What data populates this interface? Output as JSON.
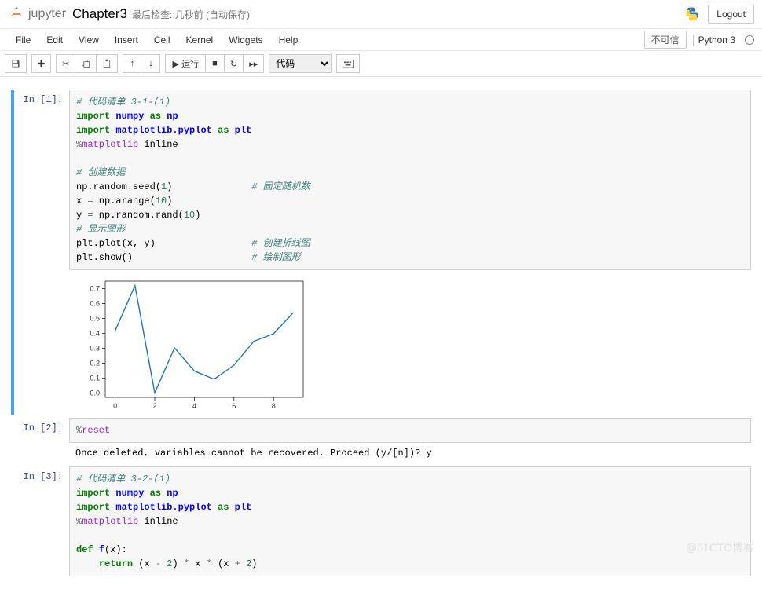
{
  "header": {
    "brand": "jupyter",
    "notebook_name": "Chapter3",
    "save_status_label": "最后检查:",
    "save_status_time": "几秒前",
    "save_status_auto": "(自动保存)",
    "logout": "Logout"
  },
  "menubar": {
    "items": [
      "File",
      "Edit",
      "View",
      "Insert",
      "Cell",
      "Kernel",
      "Widgets",
      "Help"
    ],
    "trust": "不可信",
    "kernel": "Python 3"
  },
  "toolbar": {
    "run_label": "运行",
    "cell_type": "代码"
  },
  "cells": [
    {
      "prompt": "In [1]:",
      "code_raw": "# 代码清单 3-1-(1)\nimport numpy as np\nimport matplotlib.pyplot as plt\n%matplotlib inline\n\n# 创建数据\nnp.random.seed(1)              # 固定随机数\nx = np.arange(10)\ny = np.random.rand(10)\n# 显示图形\nplt.plot(x, y)                 # 创建折线图\nplt.show()                     # 绘制图形"
    },
    {
      "prompt": "In [2]:",
      "code_raw": "%reset",
      "output": "Once deleted, variables cannot be recovered. Proceed (y/[n])? y"
    },
    {
      "prompt": "In [3]:",
      "code_raw": "# 代码清单 3-2-(1)\nimport numpy as np\nimport matplotlib.pyplot as plt\n%matplotlib inline\n\ndef f(x):\n    return (x - 2) * x * (x + 2)"
    }
  ],
  "chart_data": {
    "type": "line",
    "x": [
      0,
      1,
      2,
      3,
      4,
      5,
      6,
      7,
      8,
      9
    ],
    "y": [
      0.417,
      0.72,
      0.0,
      0.302,
      0.147,
      0.092,
      0.186,
      0.346,
      0.397,
      0.539
    ],
    "yticks": [
      0.0,
      0.1,
      0.2,
      0.3,
      0.4,
      0.5,
      0.6,
      0.7
    ],
    "xticks": [
      0,
      2,
      4,
      6,
      8
    ],
    "xlim": [
      -0.5,
      9.5
    ],
    "ylim": [
      -0.03,
      0.75
    ],
    "title": "",
    "xlabel": "",
    "ylabel": ""
  },
  "watermark": "@51CTO博客"
}
